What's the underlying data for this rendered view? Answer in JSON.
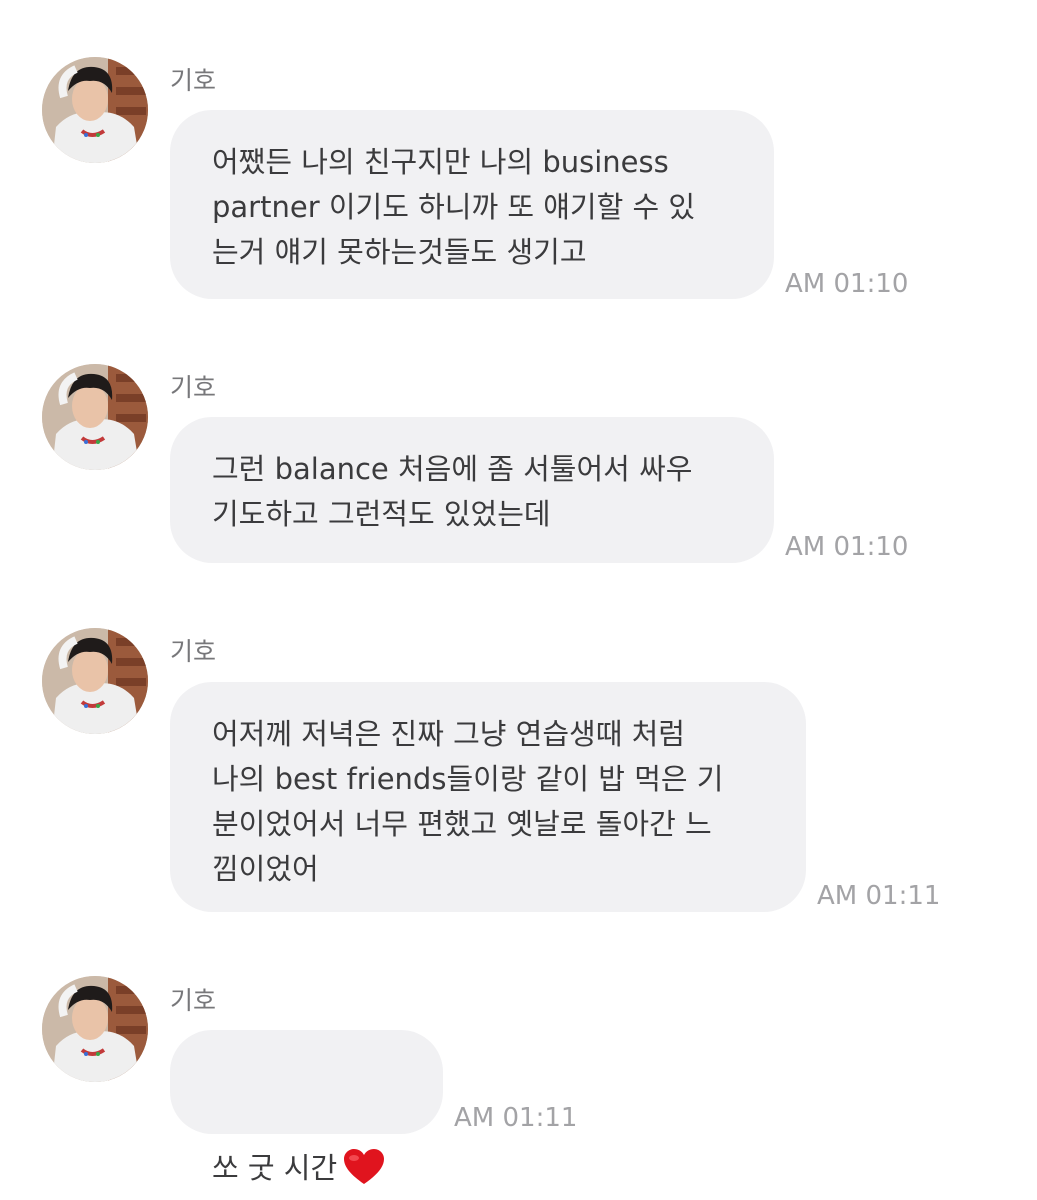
{
  "messages": [
    {
      "sender": "기호",
      "text": "어쨌든 나의 친구지만 나의 business\npartner 이기도 하니까 또 얘기할 수 있\n는거 얘기 못하는것들도 생기고",
      "time": "AM 01:10"
    },
    {
      "sender": "기호",
      "text": "그런 balance 처음에 좀 서툴어서 싸우\n기도하고 그런적도 있었는데",
      "time": "AM 01:10"
    },
    {
      "sender": "기호",
      "text": "어저께 저녁은 진짜 그냥 연습생때 처럼\n나의 best friends들이랑 같이 밥 먹은 기\n분이었어서 너무 편했고 옛날로 돌아간 느\n낌이었어",
      "time": "AM 01:11"
    },
    {
      "sender": "기호",
      "text": "쏘 굿 시간",
      "emoji": "heart-emoji",
      "time": "AM 01:11"
    }
  ],
  "colors": {
    "bubble": "#f1f1f3",
    "sender": "#77777a",
    "time": "#a3a3a6",
    "heart": "#e0141e"
  }
}
